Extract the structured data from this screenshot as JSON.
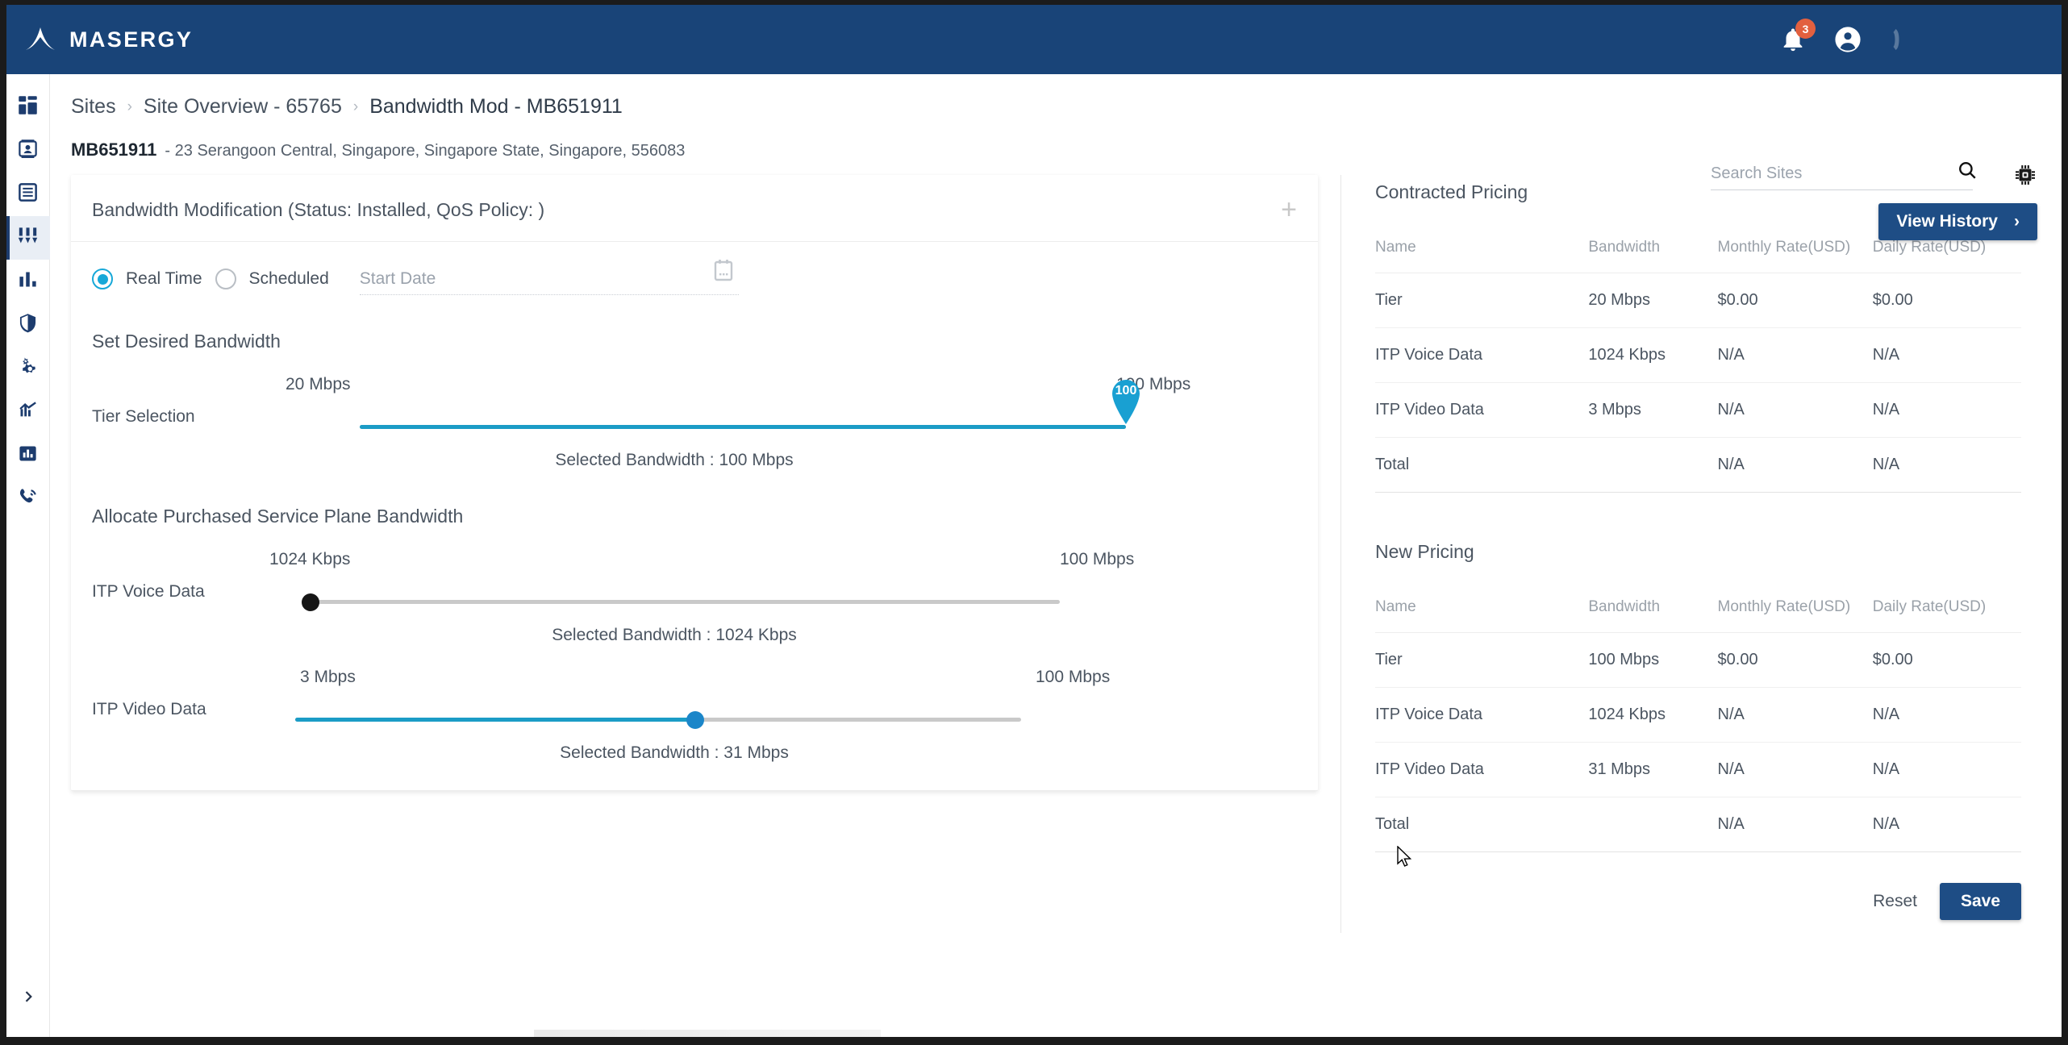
{
  "brand": {
    "name": "MASERGY"
  },
  "topbar": {
    "notifications_count": "3",
    "bell_icon": "bell-icon",
    "account_icon": "account-circle-icon"
  },
  "search": {
    "placeholder": "Search Sites",
    "value": "",
    "icon": "search-icon"
  },
  "settings": {
    "icon": "chip-settings-icon"
  },
  "history_button": {
    "label": "View History",
    "arrow": "›"
  },
  "breadcrumb": {
    "items": [
      {
        "label": "Sites"
      },
      {
        "label": "Site Overview - 65765"
      },
      {
        "label": "Bandwidth Mod - MB651911"
      }
    ],
    "separator": "›"
  },
  "site": {
    "code": "MB651911",
    "address": "- 23 Serangoon Central, Singapore, Singapore State, Singapore, 556083"
  },
  "sidebar": {
    "items": [
      {
        "name": "dashboard",
        "icon": "dashboard-grid-icon",
        "active": false
      },
      {
        "name": "contacts",
        "icon": "contact-card-icon",
        "active": false
      },
      {
        "name": "documents",
        "icon": "list-document-icon",
        "active": false
      },
      {
        "name": "bandwidth",
        "icon": "sliders-icon",
        "active": true
      },
      {
        "name": "reports",
        "icon": "bar-chart-icon",
        "active": false
      },
      {
        "name": "security",
        "icon": "shield-icon",
        "active": false
      },
      {
        "name": "settings",
        "icon": "gears-icon",
        "active": false
      },
      {
        "name": "analytics",
        "icon": "trending-chart-icon",
        "active": false
      },
      {
        "name": "statistics",
        "icon": "chart-box-icon",
        "active": false
      },
      {
        "name": "voice",
        "icon": "phone-ring-icon",
        "active": false
      }
    ],
    "expand_icon": "chevron-right-icon"
  },
  "bandwidth_card": {
    "header": "Bandwidth Modification (Status: Installed, QoS Policy: )",
    "expand_label": "+",
    "mode": {
      "realtime_label": "Real Time",
      "scheduled_label": "Scheduled",
      "selected": "Real Time"
    },
    "start_date": {
      "placeholder": "Start Date",
      "value": "",
      "icon": "calendar-icon"
    },
    "set_desired_title": "Set Desired Bandwidth",
    "allocate_title": "Allocate Purchased Service Plane Bandwidth",
    "sliders": [
      {
        "label": "Tier Selection",
        "min_label": "20 Mbps",
        "max_label": "100 Mbps",
        "pin_value": "100",
        "selected_text": "Selected Bandwidth : 100 Mbps",
        "fill_percent": 100,
        "handle": "pin"
      },
      {
        "label": "ITP Voice Data",
        "min_label": "1024 Kbps",
        "max_label": "100 Mbps",
        "selected_text": "Selected Bandwidth : 1024 Kbps",
        "fill_percent": 0,
        "handle": "dark-round"
      },
      {
        "label": "ITP Video Data",
        "min_label": "3 Mbps",
        "max_label": "100 Mbps",
        "selected_text": "Selected Bandwidth : 31 Mbps",
        "fill_percent": 55,
        "handle": "blue-round"
      }
    ]
  },
  "pricing": {
    "columns": [
      "Name",
      "Bandwidth",
      "Monthly Rate(USD)",
      "Daily Rate(USD)"
    ],
    "contracted": {
      "title": "Contracted Pricing",
      "rows": [
        {
          "name": "Tier",
          "bandwidth": "20 Mbps",
          "monthly": "$0.00",
          "daily": "$0.00"
        },
        {
          "name": "ITP Voice Data",
          "bandwidth": "1024 Kbps",
          "monthly": "N/A",
          "daily": "N/A"
        },
        {
          "name": "ITP Video Data",
          "bandwidth": "3 Mbps",
          "monthly": "N/A",
          "daily": "N/A"
        },
        {
          "name": "Total",
          "bandwidth": "",
          "monthly": "N/A",
          "daily": "N/A"
        }
      ]
    },
    "new": {
      "title": "New Pricing",
      "rows": [
        {
          "name": "Tier",
          "bandwidth": "100 Mbps",
          "monthly": "$0.00",
          "daily": "$0.00"
        },
        {
          "name": "ITP Voice Data",
          "bandwidth": "1024 Kbps",
          "monthly": "N/A",
          "daily": "N/A"
        },
        {
          "name": "ITP Video Data",
          "bandwidth": "31 Mbps",
          "monthly": "N/A",
          "daily": "N/A"
        },
        {
          "name": "Total",
          "bandwidth": "",
          "monthly": "N/A",
          "daily": "N/A"
        }
      ]
    }
  },
  "actions": {
    "reset_label": "Reset",
    "save_label": "Save"
  },
  "colors": {
    "brand_blue": "#194478",
    "button_blue": "#1e4d85",
    "slider_teal": "#1b9cc6",
    "accent_cyan": "#17a8d8",
    "badge_orange": "#e2603f"
  }
}
